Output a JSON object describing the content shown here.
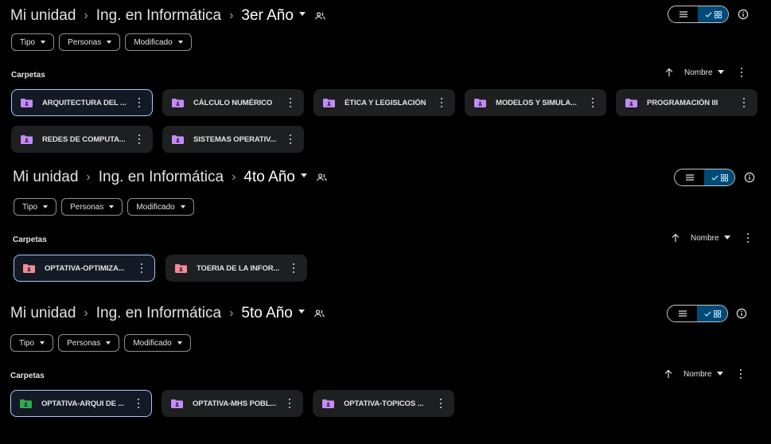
{
  "colors": {
    "background": "#000000",
    "card": "#1e1f20",
    "selected_border": "#a8c7fa",
    "toggle_active": "#004a77",
    "folder_purple": "#c58af9",
    "folder_pink": "#f28b9a",
    "folder_green": "#34a853"
  },
  "sections": [
    {
      "breadcrumb": [
        "Mi unidad",
        "Ing. en Informática",
        "3er Año"
      ],
      "filters": [
        "Tipo",
        "Personas",
        "Modificado"
      ],
      "folders_label": "Carpetas",
      "sort_label": "Nombre",
      "folders": [
        {
          "title": "ARQUITECTURA DEL ...",
          "color": "purple",
          "selected": true
        },
        {
          "title": "CÁLCULO NUMÉRICO",
          "color": "purple",
          "selected": false
        },
        {
          "title": "ÉTICA Y LEGISLACIÓN",
          "color": "purple",
          "selected": false
        },
        {
          "title": "MODELOS Y SIMULA...",
          "color": "purple",
          "selected": false
        },
        {
          "title": "PROGRAMACIÓN III",
          "color": "purple",
          "selected": false
        },
        {
          "title": "REDES DE COMPUTA...",
          "color": "purple",
          "selected": false
        },
        {
          "title": "SISTEMAS OPERATIV...",
          "color": "purple",
          "selected": false
        }
      ]
    },
    {
      "breadcrumb": [
        "Mi unidad",
        "Ing. en Informática",
        "4to Año"
      ],
      "filters": [
        "Tipo",
        "Personas",
        "Modificado"
      ],
      "folders_label": "Carpetas",
      "sort_label": "Nombre",
      "folders": [
        {
          "title": "OPTATIVA-OPTIMIZA...",
          "color": "pink",
          "selected": true
        },
        {
          "title": "TOERIA DE LA INFOR...",
          "color": "pink",
          "selected": false
        }
      ]
    },
    {
      "breadcrumb": [
        "Mi unidad",
        "Ing. en Informática",
        "5to Año"
      ],
      "filters": [
        "Tipo",
        "Personas",
        "Modificado"
      ],
      "folders_label": "Carpetas",
      "sort_label": "Nombre",
      "folders": [
        {
          "title": "OPTATIVA-ARQUI DE ...",
          "color": "green",
          "selected": true
        },
        {
          "title": "OPTATIVA-MHS POBL...",
          "color": "purple",
          "selected": false
        },
        {
          "title": "OPTATIVA-TOPICOS ...",
          "color": "purple",
          "selected": false
        }
      ]
    }
  ]
}
